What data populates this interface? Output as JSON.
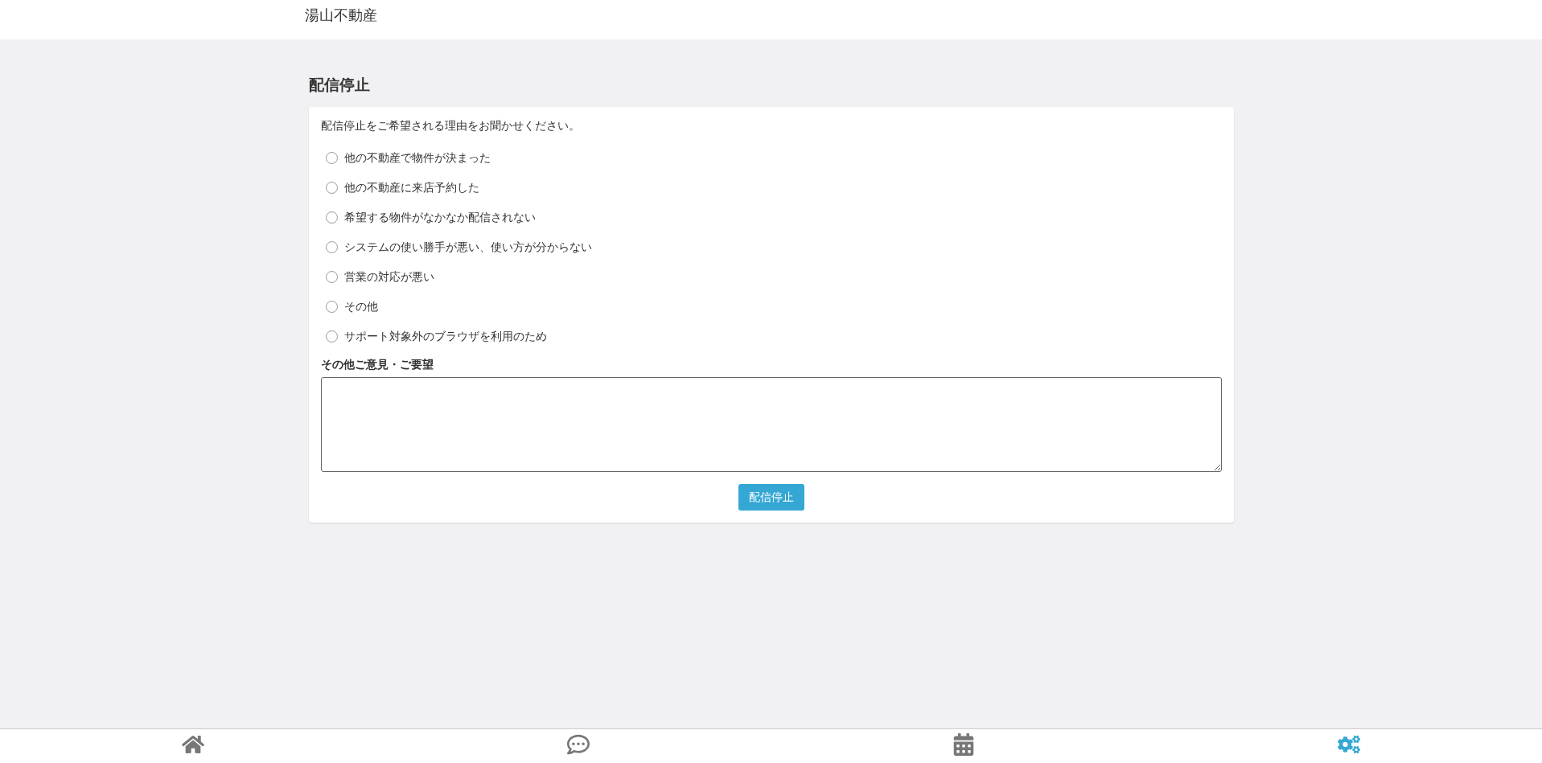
{
  "header": {
    "title": "湯山不動産"
  },
  "page_title": "配信停止",
  "form": {
    "prompt": "配信停止をご希望される理由をお聞かせください。",
    "reasons": [
      {
        "label": "他の不動産で物件が決まった",
        "selected": false
      },
      {
        "label": "他の不動産に来店予約した",
        "selected": false
      },
      {
        "label": "希望する物件がなかなか配信されない",
        "selected": false
      },
      {
        "label": "システムの使い勝手が悪い、使い方が分からない",
        "selected": false
      },
      {
        "label": "営業の対応が悪い",
        "selected": false
      },
      {
        "label": "その他",
        "selected": false
      },
      {
        "label": "サポート対象外のブラウザを利用のため",
        "selected": false
      }
    ],
    "comment_label": "その他ご意見・ご要望",
    "submit": "配信停止"
  },
  "bottom_nav": [
    {
      "kind": "home",
      "selected": false
    },
    {
      "kind": "chat",
      "selected": false
    },
    {
      "kind": "calendar",
      "selected": false
    },
    {
      "kind": "settings",
      "selected": true
    }
  ]
}
